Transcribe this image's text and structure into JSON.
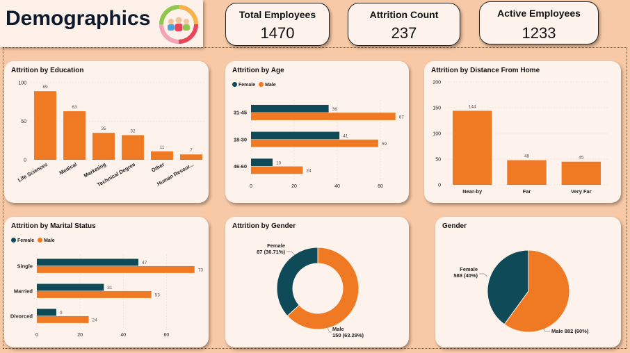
{
  "page_title": "Demographics",
  "kpis": [
    {
      "label": "Total Employees",
      "value": "1470"
    },
    {
      "label": "Attrition Count",
      "value": "237"
    },
    {
      "label": "Active Employees",
      "value": "1233"
    }
  ],
  "colors": {
    "female": "#0e4a57",
    "male": "#f07a23",
    "card": "#fdf3ec",
    "background": "#f7c9a6"
  },
  "chart_data": [
    {
      "id": "education",
      "type": "bar",
      "title": "Attrition by Education",
      "categories": [
        "Life Sciences",
        "Medical",
        "Marketing",
        "Technical Degree",
        "Other",
        "Human Resour..."
      ],
      "values": [
        89,
        63,
        35,
        32,
        11,
        7
      ],
      "yticks": [
        0,
        50,
        100
      ],
      "ylim": [
        0,
        100
      ]
    },
    {
      "id": "age",
      "type": "bar",
      "orientation": "horizontal",
      "title": "Attrition by Age",
      "legend": [
        "Female",
        "Male"
      ],
      "categories": [
        "31-45",
        "18-30",
        "46-60"
      ],
      "series": [
        {
          "name": "Female",
          "values": [
            36,
            41,
            10
          ]
        },
        {
          "name": "Male",
          "values": [
            67,
            59,
            24
          ]
        }
      ],
      "xticks": [
        0,
        20,
        40,
        60
      ],
      "xlim": [
        0,
        70
      ]
    },
    {
      "id": "distance",
      "type": "bar",
      "title": "Attrition by Distance From Home",
      "categories": [
        "Near-by",
        "Far",
        "Very Far"
      ],
      "values": [
        144,
        48,
        45
      ],
      "yticks": [
        0,
        50,
        100,
        150,
        200
      ],
      "ylim": [
        0,
        200
      ]
    },
    {
      "id": "marital",
      "type": "bar",
      "orientation": "horizontal",
      "title": "Attrition by Marital Status",
      "legend": [
        "Female",
        "Male"
      ],
      "categories": [
        "Single",
        "Married",
        "Divorced"
      ],
      "series": [
        {
          "name": "Female",
          "values": [
            47,
            31,
            9
          ]
        },
        {
          "name": "Male",
          "values": [
            73,
            53,
            24
          ]
        }
      ],
      "xticks": [
        0,
        20,
        40,
        60
      ],
      "xlim": [
        0,
        75
      ]
    },
    {
      "id": "attr_gender",
      "type": "pie",
      "donut": true,
      "title": "Attrition by Gender",
      "labels": [
        "Female",
        "Male"
      ],
      "values": [
        87,
        150
      ],
      "label_texts": [
        [
          "Female",
          "87 (36.71%)"
        ],
        [
          "Male",
          "150 (63.29%)"
        ]
      ]
    },
    {
      "id": "gender",
      "type": "pie",
      "donut": false,
      "title": "Gender",
      "labels": [
        "Female",
        "Male"
      ],
      "values": [
        588,
        882
      ],
      "label_texts": [
        [
          "Female",
          "588 (40%)"
        ],
        [
          "Male 882 (60%)"
        ]
      ]
    }
  ]
}
